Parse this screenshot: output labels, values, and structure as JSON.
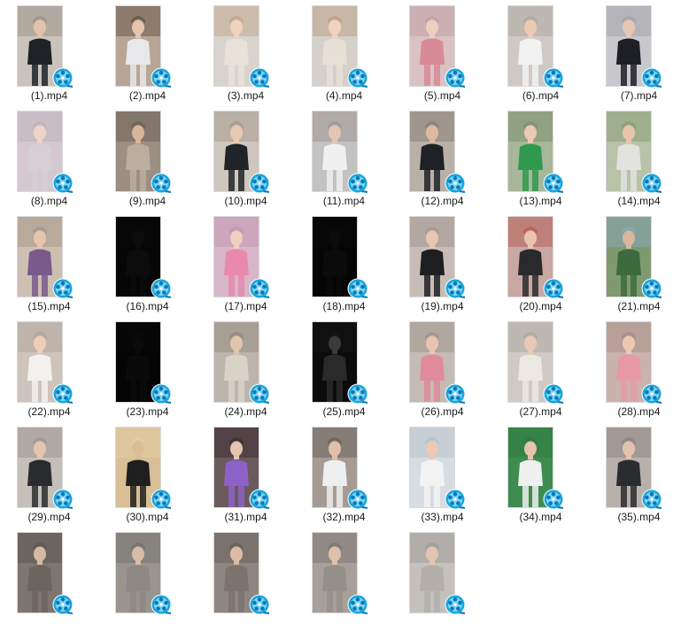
{
  "view": "file-explorer-large-icons",
  "file_icon": "media-player-video-icon",
  "files": [
    {
      "name": "(1).mp4",
      "thumb": {
        "bg": "#c9c3bb",
        "top": "#9e958b",
        "fig": "#1f2328",
        "skin": "#e2c2aa"
      }
    },
    {
      "name": "(2).mp4",
      "thumb": {
        "bg": "#b7a596",
        "top": "#6b5a4d",
        "fig": "#e8e8ea",
        "skin": "#e6c4ad"
      }
    },
    {
      "name": "(3).mp4",
      "thumb": {
        "bg": "#d8d3cd",
        "top": "#c2a98f",
        "fig": "#e9e2d8",
        "skin": "#f0d2bf"
      }
    },
    {
      "name": "(4).mp4",
      "thumb": {
        "bg": "#d5d0ca",
        "top": "#bba28a",
        "fig": "#e7e0d7",
        "skin": "#f1d3c0"
      }
    },
    {
      "name": "(5).mp4",
      "thumb": {
        "bg": "#d9c1c4",
        "top": "#c3a2a8",
        "fig": "#d88a97",
        "skin": "#efcfbe"
      }
    },
    {
      "name": "(6).mp4",
      "thumb": {
        "bg": "#cfc9c5",
        "top": "#b1a9a3",
        "fig": "#f2f2f2",
        "skin": "#ebcbb6"
      }
    },
    {
      "name": "(7).mp4",
      "thumb": {
        "bg": "#c8c8cc",
        "top": "#a4a4aa",
        "fig": "#1d1f24",
        "skin": "#e6c7b3"
      }
    },
    {
      "name": "(8).mp4",
      "thumb": {
        "bg": "#d4c9d1",
        "top": "#bfb2bb",
        "fig": "#d6cfd6",
        "skin": "#efd3c6"
      }
    },
    {
      "name": "(9).mp4",
      "thumb": {
        "bg": "#9b8f83",
        "top": "#6f6358",
        "fig": "#bcae9f",
        "skin": "#d9b599"
      }
    },
    {
      "name": "(10).mp4",
      "thumb": {
        "bg": "#cfc6bd",
        "top": "#a89c90",
        "fig": "#202428",
        "skin": "#e8c9b4"
      }
    },
    {
      "name": "(11).mp4",
      "thumb": {
        "bg": "#c4c2c0",
        "top": "#9d9996",
        "fig": "#f0f0f0",
        "skin": "#e5c6b2"
      }
    },
    {
      "name": "(12).mp4",
      "thumb": {
        "bg": "#b9b1a8",
        "top": "#8b8279",
        "fig": "#1e2226",
        "skin": "#deb9a0"
      }
    },
    {
      "name": "(13).mp4",
      "thumb": {
        "bg": "#a7b79a",
        "top": "#7e9270",
        "fig": "#2f9a4d",
        "skin": "#ecc9b2"
      }
    },
    {
      "name": "(14).mp4",
      "thumb": {
        "bg": "#b7c2a8",
        "top": "#8aa076",
        "fig": "#e2e2de",
        "skin": "#e8c6ae"
      }
    },
    {
      "name": "(15).mp4",
      "thumb": {
        "bg": "#cdbfb2",
        "top": "#a9998b",
        "fig": "#7a5a8c",
        "skin": "#e7c5ad"
      }
    },
    {
      "name": "(16).mp4",
      "thumb": {
        "bg": "#060606",
        "top": "#0a0a0a",
        "fig": "#0c0c0c",
        "skin": "#0c0c0c"
      }
    },
    {
      "name": "(17).mp4",
      "thumb": {
        "bg": "#d7b6c9",
        "top": "#c199b3",
        "fig": "#e98aac",
        "skin": "#f0cfbf"
      }
    },
    {
      "name": "(18).mp4",
      "thumb": {
        "bg": "#050505",
        "top": "#0a0a0a",
        "fig": "#0b0b0b",
        "skin": "#0b0b0b"
      }
    },
    {
      "name": "(19).mp4",
      "thumb": {
        "bg": "#c7bdb6",
        "top": "#a39790",
        "fig": "#1f1f22",
        "skin": "#e9c6b1"
      }
    },
    {
      "name": "(20).mp4",
      "thumb": {
        "bg": "#c9a7a3",
        "top": "#b8605a",
        "fig": "#2a2a2c",
        "skin": "#e9c4ac"
      }
    },
    {
      "name": "(21).mp4",
      "thumb": {
        "bg": "#7f9a6f",
        "top": "#8aa7b8",
        "fig": "#3d6b3e",
        "skin": "#d8b79e"
      }
    },
    {
      "name": "(22).mp4",
      "thumb": {
        "bg": "#cdc4bd",
        "top": "#b3a79e",
        "fig": "#f2f1ee",
        "skin": "#eecdb9"
      }
    },
    {
      "name": "(23).mp4",
      "thumb": {
        "bg": "#040404",
        "top": "#090909",
        "fig": "#0a0a0a",
        "skin": "#0a0a0a"
      }
    },
    {
      "name": "(24).mp4",
      "thumb": {
        "bg": "#bdb5ab",
        "top": "#958b81",
        "fig": "#d9d2c7",
        "skin": "#e2c3ad"
      }
    },
    {
      "name": "(25).mp4",
      "thumb": {
        "bg": "#0b0b0b",
        "top": "#151515",
        "fig": "#2a2a2a",
        "skin": "#3a3a3a"
      }
    },
    {
      "name": "(26).mp4",
      "thumb": {
        "bg": "#c4bcb4",
        "top": "#a0968d",
        "fig": "#e08b9a",
        "skin": "#e8c5af"
      }
    },
    {
      "name": "(27).mp4",
      "thumb": {
        "bg": "#cfcac5",
        "top": "#b0aaa4",
        "fig": "#ece8e2",
        "skin": "#e9cab5"
      }
    },
    {
      "name": "(28).mp4",
      "thumb": {
        "bg": "#c9b3ad",
        "top": "#a98f88",
        "fig": "#e79aa5",
        "skin": "#ecc7b2"
      }
    },
    {
      "name": "(29).mp4",
      "thumb": {
        "bg": "#c5bfba",
        "top": "#9f9893",
        "fig": "#2a2b2e",
        "skin": "#e4c4b0"
      }
    },
    {
      "name": "(30).mp4",
      "thumb": {
        "bg": "#d8bf96",
        "top": "#e3cca4",
        "fig": "#1f1f1f",
        "skin": "#d8bf96"
      }
    },
    {
      "name": "(31).mp4",
      "thumb": {
        "bg": "#6b5a5c",
        "top": "#3f3234",
        "fig": "#8d62c8",
        "skin": "#e6c4b2"
      }
    },
    {
      "name": "(32).mp4",
      "thumb": {
        "bg": "#a59b93",
        "top": "#6e655e",
        "fig": "#efefef",
        "skin": "#e1c0aa"
      }
    },
    {
      "name": "(33).mp4",
      "thumb": {
        "bg": "#d6dce2",
        "top": "#b9c3cc",
        "fig": "#f3f3f3",
        "skin": "#eccab4"
      }
    },
    {
      "name": "(34).mp4",
      "thumb": {
        "bg": "#3f8c50",
        "top": "#2f7a40",
        "fig": "#f0f0f0",
        "skin": "#e5c3ad"
      }
    },
    {
      "name": "(35).mp4",
      "thumb": {
        "bg": "#b8b1ab",
        "top": "#8e8781",
        "fig": "#2a2c30",
        "skin": "#e3c2ad"
      }
    },
    {
      "name": "",
      "thumb": {
        "bg": "#7d7670",
        "top": "#5e5852",
        "fig": "#6b6560",
        "skin": "#d7b8a4"
      }
    },
    {
      "name": "",
      "thumb": {
        "bg": "#9a948f",
        "top": "#77726d",
        "fig": "#8d8883",
        "skin": "#d9bba7"
      }
    },
    {
      "name": "",
      "thumb": {
        "bg": "#8e8680",
        "top": "#6a635d",
        "fig": "#7b746e",
        "skin": "#dcbca6"
      }
    },
    {
      "name": "",
      "thumb": {
        "bg": "#a7a09a",
        "top": "#7f7872",
        "fig": "#958f89",
        "skin": "#dfc0ab"
      }
    },
    {
      "name": "",
      "thumb": {
        "bg": "#c4c0bc",
        "top": "#a29d98",
        "fig": "#b3aeaa",
        "skin": "#e2c4b0"
      }
    }
  ]
}
